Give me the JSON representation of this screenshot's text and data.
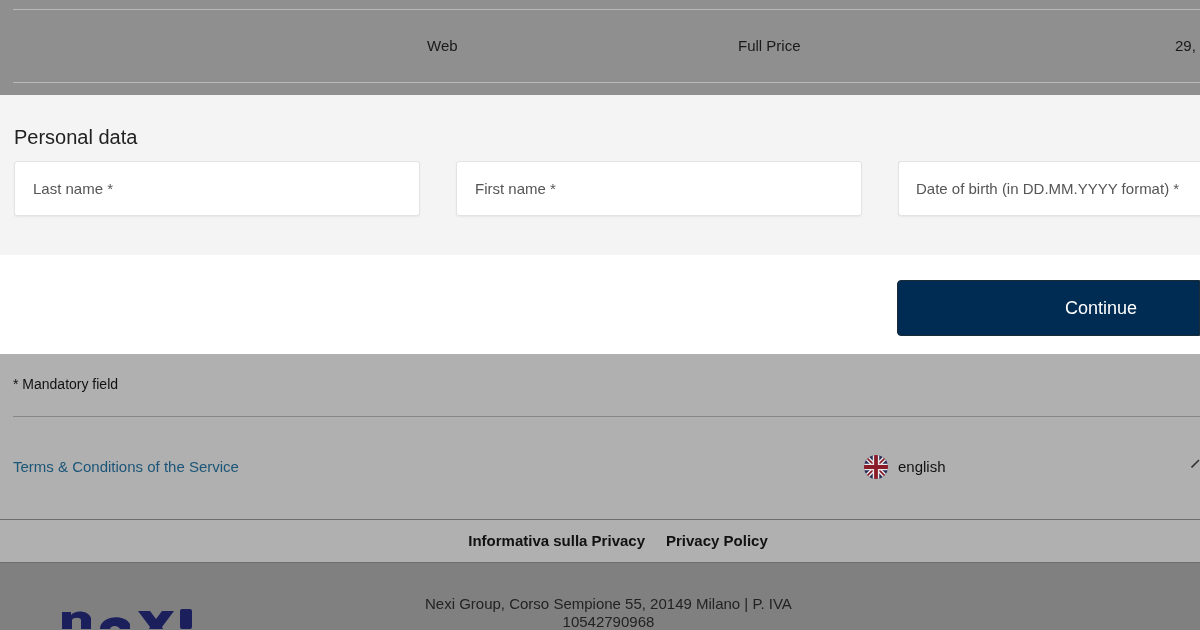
{
  "table_row": {
    "cells": [
      "Web",
      "Full Price",
      "29,"
    ]
  },
  "personal_data": {
    "title": "Personal data",
    "fields": [
      {
        "placeholder": "Last name *"
      },
      {
        "placeholder": "First name *"
      },
      {
        "placeholder": "Date of birth (in DD.MM.YYYY format) *"
      }
    ]
  },
  "continue_button": {
    "label": "Continue"
  },
  "mandatory_note": "* Mandatory field",
  "footer": {
    "terms_link": "Terms & Conditions of the Service",
    "language": "english"
  },
  "legal_links": [
    "Informativa sulla Privacy",
    "Privacy Policy"
  ],
  "company": {
    "address": "Nexi Group, Corso Sempione 55, 20149 Milano | P. IVA",
    "vat_number": "10542790968"
  }
}
